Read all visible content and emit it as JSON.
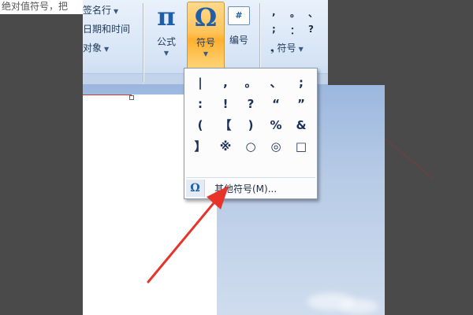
{
  "article": {
    "text": "绝对值符号，把"
  },
  "ribbon": {
    "left_items": [
      {
        "label": "签名行",
        "has_dropdown": true
      },
      {
        "label": "日期和时间",
        "has_dropdown": false
      },
      {
        "label": "对象",
        "has_dropdown": true
      }
    ],
    "formula": {
      "glyph": "π",
      "label": "公式"
    },
    "symbol": {
      "glyph": "Ω",
      "label": "符号",
      "active": true
    },
    "numbering": {
      "glyph": "#",
      "label": "编号"
    },
    "mini_symbols": [
      ",",
      "。",
      "、",
      ";",
      "：",
      "?"
    ],
    "symbols_dropdown": {
      "glyph": "❟",
      "label": "符号"
    }
  },
  "symbol_panel": {
    "symbols": [
      "|",
      ",",
      "。",
      "、",
      ";",
      ":",
      "!",
      "?",
      "“",
      "”",
      "(",
      "【",
      ")",
      "%",
      "&",
      "】",
      "※",
      "○",
      "◎",
      "□"
    ],
    "more_icon": "Ω",
    "more_label": "其他符号(M)..."
  },
  "colors": {
    "accent": "#1f5fa8",
    "active_button": "#ffc35a",
    "annotation_arrow": "#e8332a"
  }
}
